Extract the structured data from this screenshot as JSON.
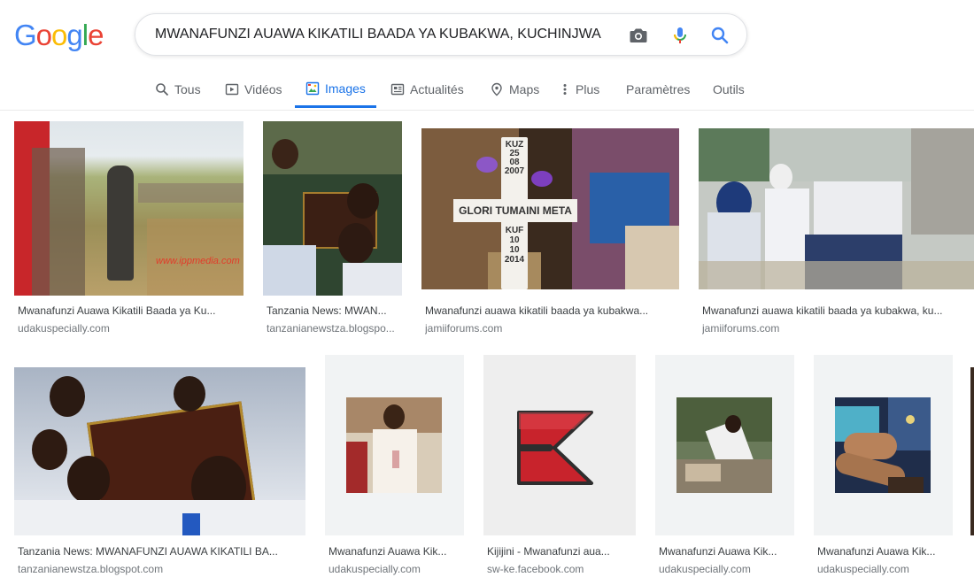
{
  "logo": {
    "text": "Google"
  },
  "search": {
    "query": "MWANAFUNZI AUAWA KIKATILI BAADA YA KUBAKWA, KUCHINJWA",
    "camera_icon": "camera-icon",
    "mic_icon": "microphone-icon",
    "search_icon": "search-icon"
  },
  "tabs": [
    {
      "label": "Tous",
      "icon": "search-icon"
    },
    {
      "label": "Vidéos",
      "icon": "video-icon"
    },
    {
      "label": "Images",
      "icon": "image-icon",
      "active": true
    },
    {
      "label": "Actualités",
      "icon": "news-icon"
    },
    {
      "label": "Maps",
      "icon": "map-pin-icon"
    },
    {
      "label": "Plus",
      "icon": "more-vertical-icon"
    },
    {
      "label": "Paramètres"
    },
    {
      "label": "Outils"
    }
  ],
  "colors": {
    "accent": "#1a73e8",
    "title_text": "#3c4043",
    "domain_text": "#70757a"
  },
  "results": [
    {
      "title": "Mwanafunzi Auawa Kikatili Baada ya Ku...",
      "domain": "udakuspecially.com",
      "image_text": "www.ippmedia.com"
    },
    {
      "title": "Tanzania News: MWAN...",
      "domain": "tanzanianewstza.blogspo..."
    },
    {
      "title": "Mwanafunzi auawa kikatili baada ya kubakwa...",
      "domain": "jamiiforums.com",
      "cross_text": [
        "KUZ",
        "25",
        "08",
        "2007",
        "GLORI TUMAINI META",
        "KUF",
        "10",
        "10",
        "2014"
      ]
    },
    {
      "title": "Mwanafunzi auawa kikatili baada ya kubakwa, ku...",
      "domain": "jamiiforums.com"
    },
    {
      "title": "Tanzania News: MWANAFUNZI AUAWA KIKATILI BA...",
      "domain": "tanzanianewstza.blogspot.com"
    },
    {
      "title": "Mwanafunzi Auawa Kik...",
      "domain": "udakuspecially.com"
    },
    {
      "title": "Kijijini - Mwanafunzi aua...",
      "domain": "sw-ke.facebook.com"
    },
    {
      "title": "Mwanafunzi Auawa Kik...",
      "domain": "udakuspecially.com"
    },
    {
      "title": "Mwanafunzi Auawa Kik...",
      "domain": "udakuspecially.com"
    }
  ]
}
